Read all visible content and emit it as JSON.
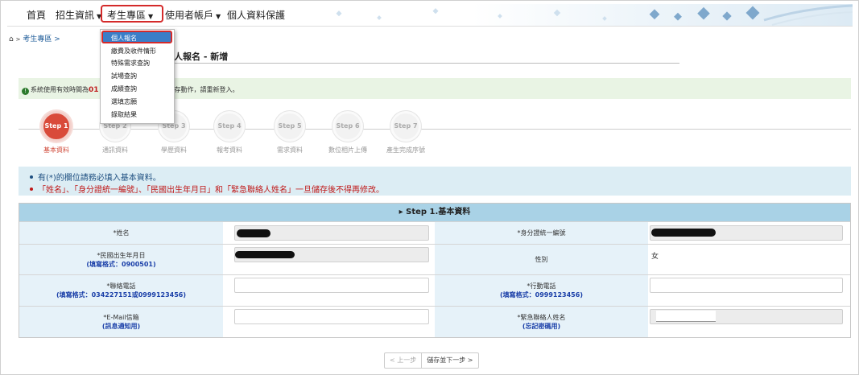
{
  "nav": {
    "items": [
      "首頁",
      "招生資訊",
      "考生專區",
      "使用者帳戶",
      "個人資料保護"
    ],
    "active": "考生專區"
  },
  "breadcrumb": "考生專區 >",
  "dropdown": {
    "items": [
      "個人報名",
      "繳費及收件情形",
      "特殊需求查詢",
      "試場查詢",
      "成績查詢",
      "選填志願",
      "錄取結果"
    ]
  },
  "page_title": "人報名 - 新增",
  "info": {
    "prefix": "系統使用有效時間為",
    "time_fragment": "01",
    "suffix": "何儲存動作，請重新登入。"
  },
  "steps": [
    {
      "badge": "Step 1",
      "label": "基本資料"
    },
    {
      "badge": "Step 2",
      "label": "通訊資料"
    },
    {
      "badge": "Step 3",
      "label": "學歷資料"
    },
    {
      "badge": "Step 4",
      "label": "報考資料"
    },
    {
      "badge": "Step 5",
      "label": "需求資料"
    },
    {
      "badge": "Step 6",
      "label": "數位相片上傳"
    },
    {
      "badge": "Step 7",
      "label": "產生完成序號"
    }
  ],
  "notes": {
    "line1": "有(*)的欄位請務必填入基本資料。",
    "line2": "「姓名」、「身分證統一編號」、「民國出生年月日」和「緊急聯絡人姓名」一旦儲存後不得再修改。"
  },
  "form": {
    "section_title": "▸ Step 1.基本資料",
    "rows": [
      {
        "left": {
          "label": "*姓名",
          "hint": ""
        },
        "right": {
          "label": "*身分證統一編號",
          "hint": ""
        }
      },
      {
        "left": {
          "label": "*民國出生年月日",
          "hint": "(填寫格式：0900501)"
        },
        "right": {
          "label": "性別",
          "hint": "",
          "value": "女"
        }
      },
      {
        "left": {
          "label": "*聯絡電話",
          "hint": "(填寫格式：034227151或0999123456)"
        },
        "right": {
          "label": "*行動電話",
          "hint": "(填寫格式：0999123456)"
        }
      },
      {
        "left": {
          "label": "*E-Mail信箱",
          "hint": "(訊息通知用)"
        },
        "right": {
          "label": "*緊急聯絡人姓名",
          "hint": "(忘記密碼用)"
        }
      }
    ]
  },
  "pager": {
    "prev": "< 上一步",
    "next": "儲存並下一步 >"
  },
  "colors": {
    "accent_red": "#d94a3a",
    "header_blue": "#a9d2e6",
    "menu_blue": "#3a7ec8"
  }
}
